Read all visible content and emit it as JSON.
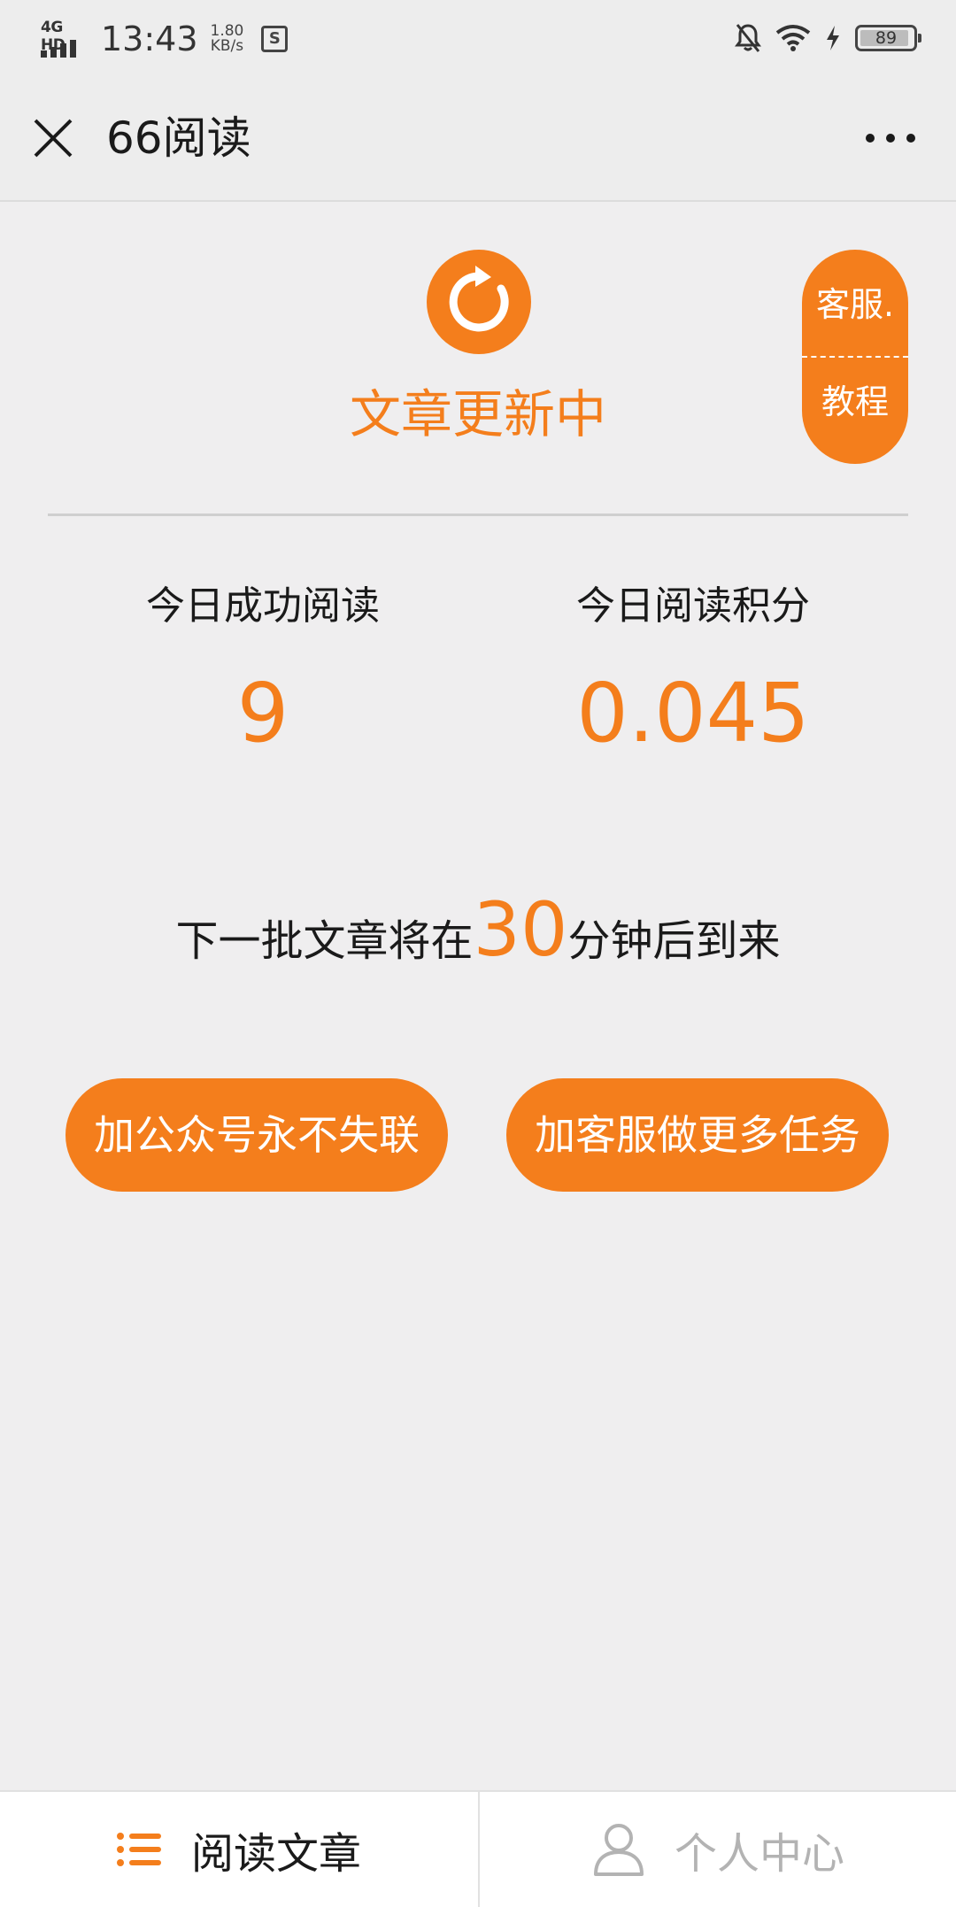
{
  "status_bar": {
    "network": "4G HD",
    "time": "13:43",
    "speed_value": "1.80",
    "speed_unit": "KB/s",
    "sim_icon": "sim-s-icon",
    "battery": "89",
    "icons": [
      "bell-muted-icon",
      "wifi-icon",
      "charging-icon",
      "battery-icon"
    ]
  },
  "nav": {
    "title": "66阅读",
    "close_icon": "close-icon",
    "more_icon": "more-icon"
  },
  "status": {
    "icon": "refresh-icon",
    "title": "文章更新中"
  },
  "service": {
    "top_label": "客服.",
    "bottom_label": "教程"
  },
  "stats": [
    {
      "label": "今日成功阅读",
      "value": "9"
    },
    {
      "label": "今日阅读积分",
      "value": "0.045"
    }
  ],
  "next_batch": {
    "prefix": "下一批文章将在",
    "minutes": "30",
    "suffix": "分钟后到来"
  },
  "actions": {
    "follow_label": "加公众号永不失联",
    "tasks_label": "加客服做更多任务"
  },
  "bottom_nav": [
    {
      "label": "阅读文章",
      "icon": "list-icon",
      "active": true
    },
    {
      "label": "个人中心",
      "icon": "user-icon",
      "active": false
    }
  ],
  "colors": {
    "accent": "#F47E1C",
    "background": "#EFEEEF",
    "inactive": "#B3B3B3"
  }
}
